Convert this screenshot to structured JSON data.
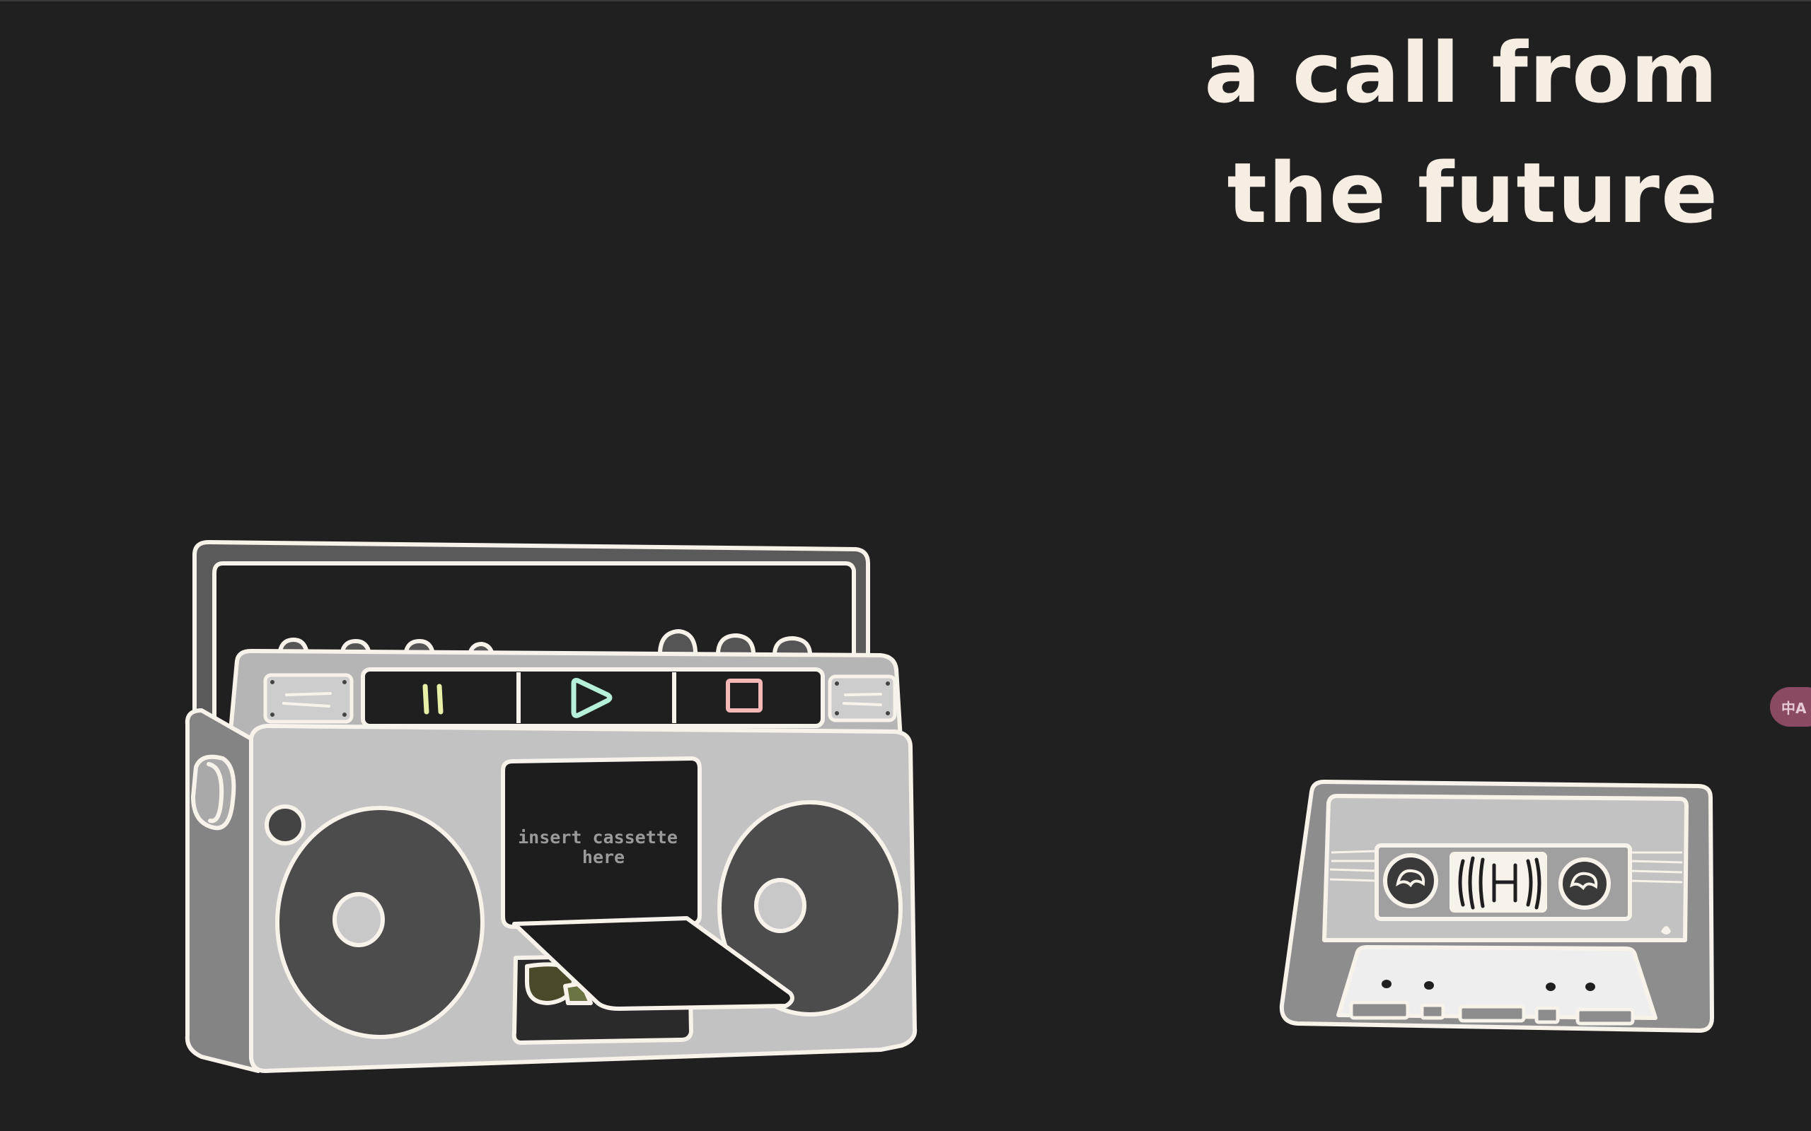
{
  "page": {
    "title_line_1": "a call from",
    "title_line_2": "the future"
  },
  "boombox": {
    "slot_text_line_1": "insert cassette",
    "slot_text_line_2": "here",
    "buttons": [
      {
        "name": "pause",
        "icon": "pause-icon",
        "color": "#e8f0a8"
      },
      {
        "name": "play",
        "icon": "play-icon",
        "color": "#b6f0d8"
      },
      {
        "name": "stop",
        "icon": "stop-icon",
        "color": "#f5b8b8"
      }
    ]
  },
  "cassette": {
    "icon": "cassette-tape-icon"
  },
  "translate_widget": {
    "label": "中A",
    "icon": "translate-icon"
  },
  "colors": {
    "background": "#202020",
    "title": "#f6eee2",
    "outline": "#f8f3ea"
  }
}
